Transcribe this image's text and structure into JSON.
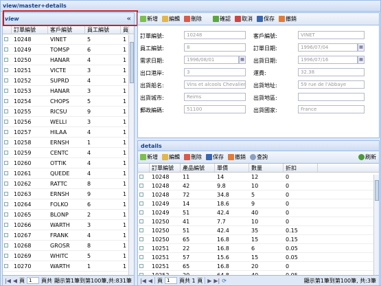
{
  "window": {
    "title": "view/master+details"
  },
  "left": {
    "title": "view",
    "collapse": "«",
    "columns": [
      "訂單編號",
      "客戶編號",
      "員工編號",
      "員"
    ],
    "rows": [
      [
        "10248",
        "VINET",
        "5",
        "1"
      ],
      [
        "10249",
        "TOMSP",
        "6",
        "1"
      ],
      [
        "10250",
        "HANAR",
        "4",
        "1"
      ],
      [
        "10251",
        "VICTE",
        "3",
        "1"
      ],
      [
        "10252",
        "SUPRD",
        "4",
        "1"
      ],
      [
        "10253",
        "HANAR",
        "3",
        "1"
      ],
      [
        "10254",
        "CHOPS",
        "5",
        "1"
      ],
      [
        "10255",
        "RICSU",
        "9",
        "1"
      ],
      [
        "10256",
        "WELLI",
        "3",
        "1"
      ],
      [
        "10257",
        "HILAA",
        "4",
        "1"
      ],
      [
        "10258",
        "ERNSH",
        "1",
        "1"
      ],
      [
        "10259",
        "CENTC",
        "4",
        "1"
      ],
      [
        "10260",
        "OTTIK",
        "4",
        "1"
      ],
      [
        "10261",
        "QUEDE",
        "4",
        "1"
      ],
      [
        "10262",
        "RATTC",
        "8",
        "1"
      ],
      [
        "10263",
        "ERNSH",
        "9",
        "1"
      ],
      [
        "10264",
        "FOLKO",
        "6",
        "1"
      ],
      [
        "10265",
        "BLONP",
        "2",
        "1"
      ],
      [
        "10266",
        "WARTH",
        "3",
        "1"
      ],
      [
        "10267",
        "FRANK",
        "4",
        "1"
      ],
      [
        "10268",
        "GROSR",
        "8",
        "1"
      ],
      [
        "10269",
        "WHITC",
        "5",
        "1"
      ],
      [
        "10270",
        "WARTH",
        "1",
        "1"
      ]
    ],
    "pager": {
      "page_label": "頁",
      "page": "1",
      "of": "頁共",
      "status": "顯示第1筆到第100筆,共:831筆"
    }
  },
  "toolbar": {
    "new": "新增",
    "edit": "編輯",
    "delete": "刪除",
    "confirm": "確認",
    "cancel": "取消",
    "save": "保存",
    "undo": "撤銷"
  },
  "form": {
    "labels": {
      "order_id": "訂單編號:",
      "customer_id": "客戶編號:",
      "employee_id": "員工編號:",
      "order_date": "訂單日期:",
      "required_date": "需求日期:",
      "shipped_date": "出貨日期:",
      "ship_via": "出口港岸:",
      "freight": "運費:",
      "ship_name": "出貨船名:",
      "ship_address": "出貨地址:",
      "ship_city": "出貨城市:",
      "ship_region": "出貨地區:",
      "postal_code": "郵政編碼:",
      "ship_country": "出貨國家:"
    },
    "values": {
      "order_id": "10248",
      "customer_id": "VINET",
      "employee_id": "8",
      "order_date": "1996/07/04",
      "required_date": "1996/08/01",
      "shipped_date": "1996/07/16",
      "ship_via": "3",
      "freight": "32.38",
      "ship_name": "Vins et alcools Chevalier",
      "ship_address": "59 rue de l'Abbaye",
      "ship_city": "Reims",
      "ship_region": "",
      "postal_code": "51100",
      "ship_country": "France"
    }
  },
  "details": {
    "title": "details",
    "toolbar": {
      "new": "新增",
      "edit": "編輯",
      "delete": "刪除",
      "save": "保存",
      "undo": "撤銷",
      "query": "查詢",
      "refresh": "刷新"
    },
    "columns": [
      "訂單編號",
      "產品編號",
      "單價",
      "數量",
      "折扣"
    ],
    "rows": [
      [
        "10248",
        "11",
        "14",
        "12",
        "0"
      ],
      [
        "10248",
        "42",
        "9.8",
        "10",
        "0"
      ],
      [
        "10248",
        "72",
        "34.8",
        "5",
        "0"
      ],
      [
        "10249",
        "14",
        "18.6",
        "9",
        "0"
      ],
      [
        "10249",
        "51",
        "42.4",
        "40",
        "0"
      ],
      [
        "10250",
        "41",
        "7.7",
        "10",
        "0"
      ],
      [
        "10250",
        "51",
        "42.4",
        "35",
        "0.15"
      ],
      [
        "10250",
        "65",
        "16.8",
        "15",
        "0.15"
      ],
      [
        "10251",
        "22",
        "16.8",
        "6",
        "0.05"
      ],
      [
        "10251",
        "57",
        "15.6",
        "15",
        "0.05"
      ],
      [
        "10251",
        "65",
        "16.8",
        "20",
        "0"
      ],
      [
        "10252",
        "20",
        "64.8",
        "40",
        "0.05"
      ]
    ],
    "pager": {
      "page_label": "頁",
      "page": "1",
      "of": "頁共 1 頁",
      "status": "顯示第1筆到第100筆, 共:3筆"
    }
  },
  "colors": {
    "accent": "#15428b",
    "border": "#99bbe8",
    "highlight": "#cc1f1f"
  }
}
